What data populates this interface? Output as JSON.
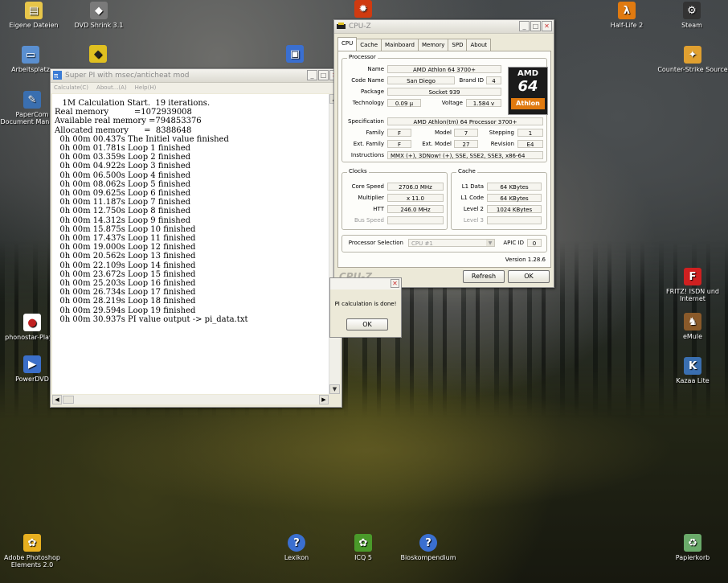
{
  "desktop": {
    "icons_left": [
      {
        "label": "Eigene Dateien",
        "icon": "folder-icon",
        "color": "#e8c64a",
        "glyph": "▤"
      },
      {
        "label": "DVD Shrink 3.1",
        "icon": "dvd-shrink-icon",
        "color": "#7a7a7a",
        "glyph": "◆"
      },
      {
        "label": "Arbeitsplatz",
        "icon": "computer-icon",
        "color": "#5a8fd0",
        "glyph": "▭"
      },
      {
        "label": "PaperCom Document Manager",
        "icon": "papercom-icon",
        "color": "#3a6fb0",
        "glyph": "✎"
      },
      {
        "label": "phonostar-Player",
        "icon": "phonostar-icon",
        "color": "#c02020",
        "glyph": "●"
      },
      {
        "label": "PowerDVD",
        "icon": "powerdvd-icon",
        "color": "#3b6fc9",
        "glyph": "▶"
      },
      {
        "label": "Adobe Photoshop Elements 2.0",
        "icon": "photoshop-flower-icon",
        "color": "#e8b020",
        "glyph": "✿"
      }
    ],
    "icons_right": [
      {
        "label": "Half-Life 2",
        "icon": "half-life-icon",
        "color": "#e07a10",
        "glyph": "λ"
      },
      {
        "label": "Steam",
        "icon": "steam-icon",
        "color": "#333333",
        "glyph": "⚙"
      },
      {
        "label": "Counter-Strike Source",
        "icon": "counter-strike-icon",
        "color": "#e0a030",
        "glyph": "✦"
      },
      {
        "label": "FRITZ! ISDN und Internet",
        "icon": "fritz-icon",
        "color": "#d02020",
        "glyph": "F"
      },
      {
        "label": "eMule",
        "icon": "emule-icon",
        "color": "#8a5a2a",
        "glyph": "♞"
      },
      {
        "label": "Kazaa Lite",
        "icon": "kazaa-icon",
        "color": "#3a6fb0",
        "glyph": "K"
      },
      {
        "label": "Papierkorb",
        "icon": "recycle-bin-icon",
        "color": "#6aaa6a",
        "glyph": "♻"
      }
    ],
    "icons_bottom": [
      {
        "label": "Lexikon",
        "icon": "help-icon",
        "color": "#3a6fd0",
        "glyph": "?"
      },
      {
        "label": "ICQ 5",
        "icon": "icq-flower-icon",
        "color": "#4a9a2a",
        "glyph": "✿"
      },
      {
        "label": "Bioskompendium",
        "icon": "help-icon",
        "color": "#3a6fd0",
        "glyph": "?"
      }
    ]
  },
  "superpi": {
    "title": "Super PI with msec/anticheat mod",
    "menu": [
      "Calculate(C)",
      "About...(A)",
      "Help(H)"
    ],
    "output_lines": [
      "   1M Calculation Start.  19 iterations.",
      "Real memory          =1072939008",
      "Available real memory =794853376",
      "Allocated memory      =  8388648",
      "  0h 00m 00.437s The Initiel value finished",
      "  0h 00m 01.781s Loop 1 finished",
      "  0h 00m 03.359s Loop 2 finished",
      "  0h 00m 04.922s Loop 3 finished",
      "  0h 00m 06.500s Loop 4 finished",
      "  0h 00m 08.062s Loop 5 finished",
      "  0h 00m 09.625s Loop 6 finished",
      "  0h 00m 11.187s Loop 7 finished",
      "  0h 00m 12.750s Loop 8 finished",
      "  0h 00m 14.312s Loop 9 finished",
      "  0h 00m 15.875s Loop 10 finished",
      "  0h 00m 17.437s Loop 11 finished",
      "  0h 00m 19.000s Loop 12 finished",
      "  0h 00m 20.562s Loop 13 finished",
      "  0h 00m 22.109s Loop 14 finished",
      "  0h 00m 23.672s Loop 15 finished",
      "  0h 00m 25.203s Loop 16 finished",
      "  0h 00m 26.734s Loop 17 finished",
      "  0h 00m 28.219s Loop 18 finished",
      "  0h 00m 29.594s Loop 19 finished",
      "  0h 00m 30.937s PI value output -> pi_data.txt"
    ]
  },
  "cpuz": {
    "title": "CPU-Z",
    "tabs": [
      "CPU",
      "Cache",
      "Mainboard",
      "Memory",
      "SPD",
      "About"
    ],
    "processor": {
      "group_label": "Processor",
      "name_label": "Name",
      "name": "AMD Athlon 64 3700+",
      "codename_label": "Code Name",
      "codename": "San Diego",
      "brandid_label": "Brand ID",
      "brandid": "4",
      "package_label": "Package",
      "package": "Socket 939",
      "technology_label": "Technology",
      "technology": "0.09 µ",
      "voltage_label": "Voltage",
      "voltage": "1.584 v",
      "spec_label": "Specification",
      "spec": "AMD Athlon(tm) 64 Processor 3700+",
      "family_label": "Family",
      "family": "F",
      "model_label": "Model",
      "model": "7",
      "stepping_label": "Stepping",
      "stepping": "1",
      "extfamily_label": "Ext. Family",
      "extfamily": "F",
      "extmodel_label": "Ext. Model",
      "extmodel": "27",
      "revision_label": "Revision",
      "revision": "E4",
      "instructions_label": "Instructions",
      "instructions": "MMX (+), 3DNow! (+), SSE, SSE2, SSE3, x86-64"
    },
    "logo": {
      "top": "AMD",
      "num": "64",
      "bottom": "Athlon"
    },
    "clocks": {
      "group_label": "Clocks",
      "core_label": "Core Speed",
      "core": "2706.0 MHz",
      "mult_label": "Multiplier",
      "mult": "x 11.0",
      "htt_label": "HTT",
      "htt": "246.0 MHz",
      "bus_label": "Bus Speed",
      "bus": ""
    },
    "cache": {
      "group_label": "Cache",
      "l1d_label": "L1 Data",
      "l1d": "64 KBytes",
      "l1c_label": "L1 Code",
      "l1c": "64 KBytes",
      "l2_label": "Level 2",
      "l2": "1024 KBytes",
      "l3_label": "Level 3",
      "l3": ""
    },
    "selection_label": "Processor Selection",
    "selection_value": "CPU #1",
    "apic_label": "APIC ID",
    "apic_value": "0",
    "version": "Version 1.28.6",
    "brand": "CPU-Z",
    "refresh_label": "Refresh",
    "ok_label": "OK"
  },
  "dialog": {
    "message": "PI calculation is done!",
    "ok_label": "OK"
  }
}
